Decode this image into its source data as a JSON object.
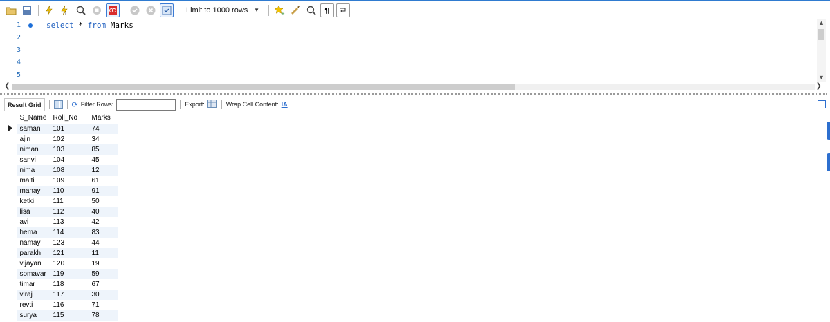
{
  "toolbar": {
    "limit_label": "Limit to 1000 rows",
    "icons": [
      "open-folder-icon",
      "save-icon",
      "execute-lightning-icon",
      "execute-cursor-icon",
      "explain-magnifier-icon",
      "stop-icon",
      "toggle-error-icon",
      "commit-icon",
      "rollback-icon",
      "autocommit-icon",
      "beautify-star-icon",
      "sweep-brush-icon",
      "find-icon",
      "invisible-chars-icon",
      "wrap-icon"
    ]
  },
  "editor": {
    "line_numbers": [
      "1",
      "2",
      "3",
      "4",
      "5"
    ],
    "code_line1": {
      "kw1": "select",
      "mid": " * ",
      "kw2": "from",
      "rest": " Marks"
    }
  },
  "result_bar": {
    "tab_label": "Result Grid",
    "filter_label": "Filter Rows:",
    "export_label": "Export:",
    "wrap_label": "Wrap Cell Content:"
  },
  "grid": {
    "columns": [
      "S_Name",
      "Roll_No",
      "Marks"
    ],
    "rows": [
      [
        "saman",
        "101",
        "74"
      ],
      [
        "ajin",
        "102",
        "34"
      ],
      [
        "niman",
        "103",
        "85"
      ],
      [
        "sanvi",
        "104",
        "45"
      ],
      [
        "nima",
        "108",
        "12"
      ],
      [
        "malti",
        "109",
        "61"
      ],
      [
        "manay",
        "110",
        "91"
      ],
      [
        "ketki",
        "111",
        "50"
      ],
      [
        "lisa",
        "112",
        "40"
      ],
      [
        "avi",
        "113",
        "42"
      ],
      [
        "hema",
        "114",
        "83"
      ],
      [
        "namay",
        "123",
        "44"
      ],
      [
        "parakh",
        "121",
        "11"
      ],
      [
        "vijayan",
        "120",
        "19"
      ],
      [
        "somavar",
        "119",
        "59"
      ],
      [
        "timar",
        "118",
        "67"
      ],
      [
        "viraj",
        "117",
        "30"
      ],
      [
        "revti",
        "116",
        "71"
      ],
      [
        "surya",
        "115",
        "78"
      ]
    ]
  },
  "colors": {
    "accent": "#2d6fcf",
    "keyword": "#1f5fbf",
    "alt_row": "#eef4fb"
  }
}
